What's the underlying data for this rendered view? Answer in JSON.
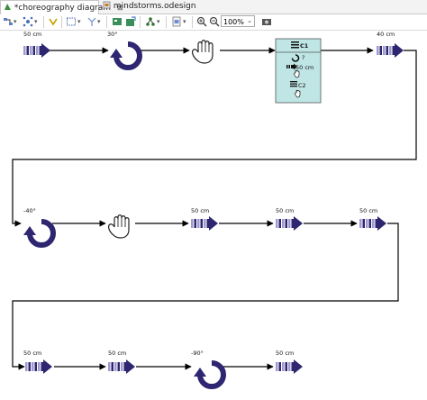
{
  "tabs": [
    {
      "label": "*choreography diagram",
      "close": "⊠",
      "icon": "diagram-icon"
    },
    {
      "label": "mindstorms.odesign",
      "icon": "odesign-file-icon"
    }
  ],
  "toolbar": {
    "zoom_value": "100%"
  },
  "diagram": {
    "row1": {
      "move1_label": "50 cm",
      "rotate1_label": "30°",
      "move2_label": "40 cm"
    },
    "loop": {
      "title": "C1",
      "rotate_label": "?",
      "move_label": "50 cm",
      "inner_title": "C2"
    },
    "row2": {
      "rotate_label": "-40°",
      "move1_label": "50 cm",
      "move2_label": "50 cm",
      "move3_label": "50 cm"
    },
    "row3": {
      "move1_label": "50 cm",
      "move2_label": "50 cm",
      "rotate_label": "-90°",
      "move3_label": "50 cm"
    },
    "colors": {
      "primary": "#2e2670",
      "stripe": "#9f9ad0",
      "loop_fill": "#bfe5e5",
      "connector": "#000000"
    }
  }
}
